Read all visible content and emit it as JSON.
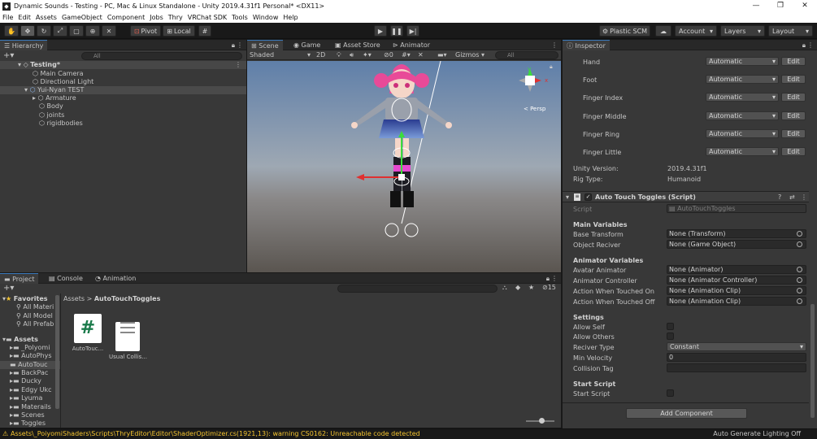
{
  "window": {
    "title": "Dynamic Sounds - Testing - PC, Mac & Linux Standalone - Unity 2019.4.31f1 Personal* <DX11>"
  },
  "menu": [
    "File",
    "Edit",
    "Assets",
    "GameObject",
    "Component",
    "Jobs",
    "Thry",
    "VRChat SDK",
    "Tools",
    "Window",
    "Help"
  ],
  "toolbar": {
    "pivot": "Pivot",
    "local": "Local",
    "plastic": "Plastic SCM",
    "account": "Account",
    "layers": "Layers",
    "layout": "Layout"
  },
  "hierarchy": {
    "tab": "Hierarchy",
    "search_placeholder": "All",
    "scene": "Testing*",
    "items": [
      "Main Camera",
      "Directional Light",
      "Yui-Nyan TEST",
      "Armature",
      "Body",
      "joints",
      "rigidbodies"
    ]
  },
  "scene": {
    "tabs": [
      "Scene",
      "Game",
      "Asset Store",
      "Animator"
    ],
    "shading": "Shaded",
    "mode2d": "2D",
    "fx_count": "0",
    "gizmos": "Gizmos",
    "search_placeholder": "All",
    "persp": "< Persp",
    "axis_y": "y",
    "axis_x": "x"
  },
  "project": {
    "tabs": [
      "Project",
      "Console",
      "Animation"
    ],
    "count": "15",
    "breadcrumb_root": "Assets",
    "breadcrumb_current": "AutoTouchToggles",
    "favorites_label": "Favorites",
    "favorites": [
      "All Materi",
      "All Model",
      "All Prefab"
    ],
    "assets_label": "Assets",
    "assets": [
      "_Polyomi",
      "AutoPhys",
      "AutoTouc",
      "BackPac",
      "Ducky",
      "Edgy Ukc",
      "Lyuma",
      "Materails",
      "Scenes",
      "Toggles"
    ],
    "files": [
      {
        "name": "AutoTouc...",
        "icon": "#"
      },
      {
        "name": "Usual Collis..."
      }
    ]
  },
  "inspector": {
    "tab": "Inspector",
    "bones": [
      {
        "label": "Hand",
        "value": "Automatic",
        "btn": "Edit"
      },
      {
        "label": "Foot",
        "value": "Automatic",
        "btn": "Edit"
      },
      {
        "label": "Finger Index",
        "value": "Automatic",
        "btn": "Edit"
      },
      {
        "label": "Finger Middle",
        "value": "Automatic",
        "btn": "Edit"
      },
      {
        "label": "Finger Ring",
        "value": "Automatic",
        "btn": "Edit"
      },
      {
        "label": "Finger Little",
        "value": "Automatic",
        "btn": "Edit"
      }
    ],
    "unity_version_label": "Unity Version:",
    "unity_version": "2019.4.31f1",
    "rig_type_label": "Rig Type:",
    "rig_type": "Humanoid",
    "component_title": "Auto Touch Toggles (Script)",
    "script_label": "Script",
    "script_value": "AutoTouchToggles",
    "main_vars": "Main Variables",
    "base_transform_label": "Base Transform",
    "base_transform": "None (Transform)",
    "object_reciver_label": "Object Reciver",
    "object_reciver": "None (Game Object)",
    "anim_vars": "Animator Variables",
    "avatar_animator_label": "Avatar Animator",
    "avatar_animator": "None (Animator)",
    "animator_controller_label": "Animator Controller",
    "animator_controller": "None (Animator Controller)",
    "touched_on_label": "Action When Touched On",
    "touched_on": "None (Animation Clip)",
    "touched_off_label": "Action When Touched Off",
    "touched_off": "None (Animation Clip)",
    "settings": "Settings",
    "allow_self_label": "Allow Self",
    "allow_others_label": "Allow Others",
    "reciver_type_label": "Reciver Type",
    "reciver_type": "Constant",
    "min_velocity_label": "Min Velocity",
    "min_velocity": "0",
    "collision_tag_label": "Collision Tag",
    "start_script_header": "Start Script",
    "start_script_label": "Start Script",
    "add_component": "Add Component"
  },
  "status": {
    "warning": "Assets\\_PoiyomiShaders\\Scripts\\ThryEditor\\Editor\\ShaderOptimizer.cs(1921,13): warning CS0162: Unreachable code detected",
    "lighting": "Auto Generate Lighting Off"
  },
  "colors": {
    "accent": "#3a79bb",
    "warning": "#f4c430"
  }
}
